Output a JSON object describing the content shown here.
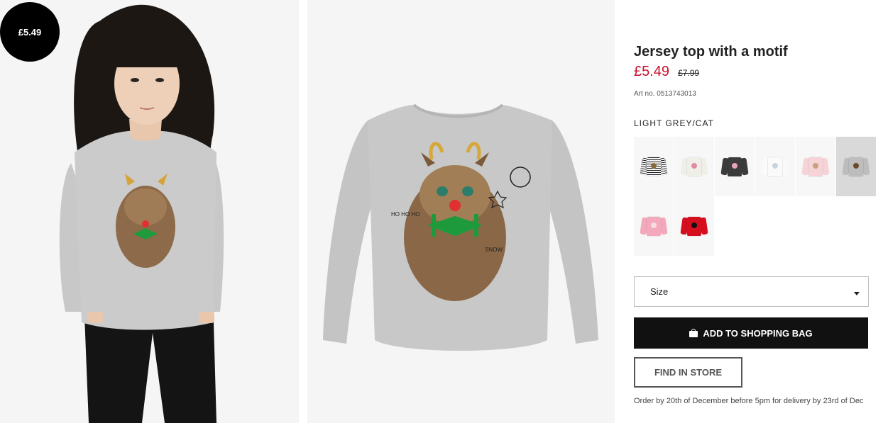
{
  "badge": {
    "price": "£5.49"
  },
  "product": {
    "title": "Jersey top with a motif",
    "price_now": "£5.49",
    "price_old": "£7.99",
    "art_no": "Art no. 0513743013",
    "colour_name": "LIGHT GREY/CAT",
    "size_label": "Size",
    "add_label": "ADD TO SHOPPING BAG",
    "store_label": "FIND IN STORE",
    "delivery_note": "Order by 20th of December before 5pm for delivery by 23rd of Dec"
  },
  "swatches": [
    {
      "name": "striped",
      "body": "#f4f4f4",
      "stripe": "#222",
      "motif": "#8a6a3a",
      "selected": false
    },
    {
      "name": "off-white",
      "body": "#efefe8",
      "motif": "#e08aa6",
      "selected": false
    },
    {
      "name": "dark-grey",
      "body": "#3b3b3b",
      "motif": "#e6a4b4",
      "selected": false
    },
    {
      "name": "white",
      "body": "#fafafa",
      "motif": "#c9d2df",
      "selected": false
    },
    {
      "name": "light-pink",
      "body": "#f5d3d6",
      "motif": "#c9a07a",
      "selected": false
    },
    {
      "name": "light-grey-cat",
      "body": "#bdbdbd",
      "motif": "#6b4a2a",
      "selected": true
    },
    {
      "name": "pink",
      "body": "#f4a8bb",
      "motif": "#f7dbe2",
      "selected": false
    },
    {
      "name": "red",
      "body": "#d60f1f",
      "motif": "#111",
      "selected": false
    }
  ],
  "colors": {
    "price_red": "#c8102e",
    "button_black": "#111111"
  }
}
